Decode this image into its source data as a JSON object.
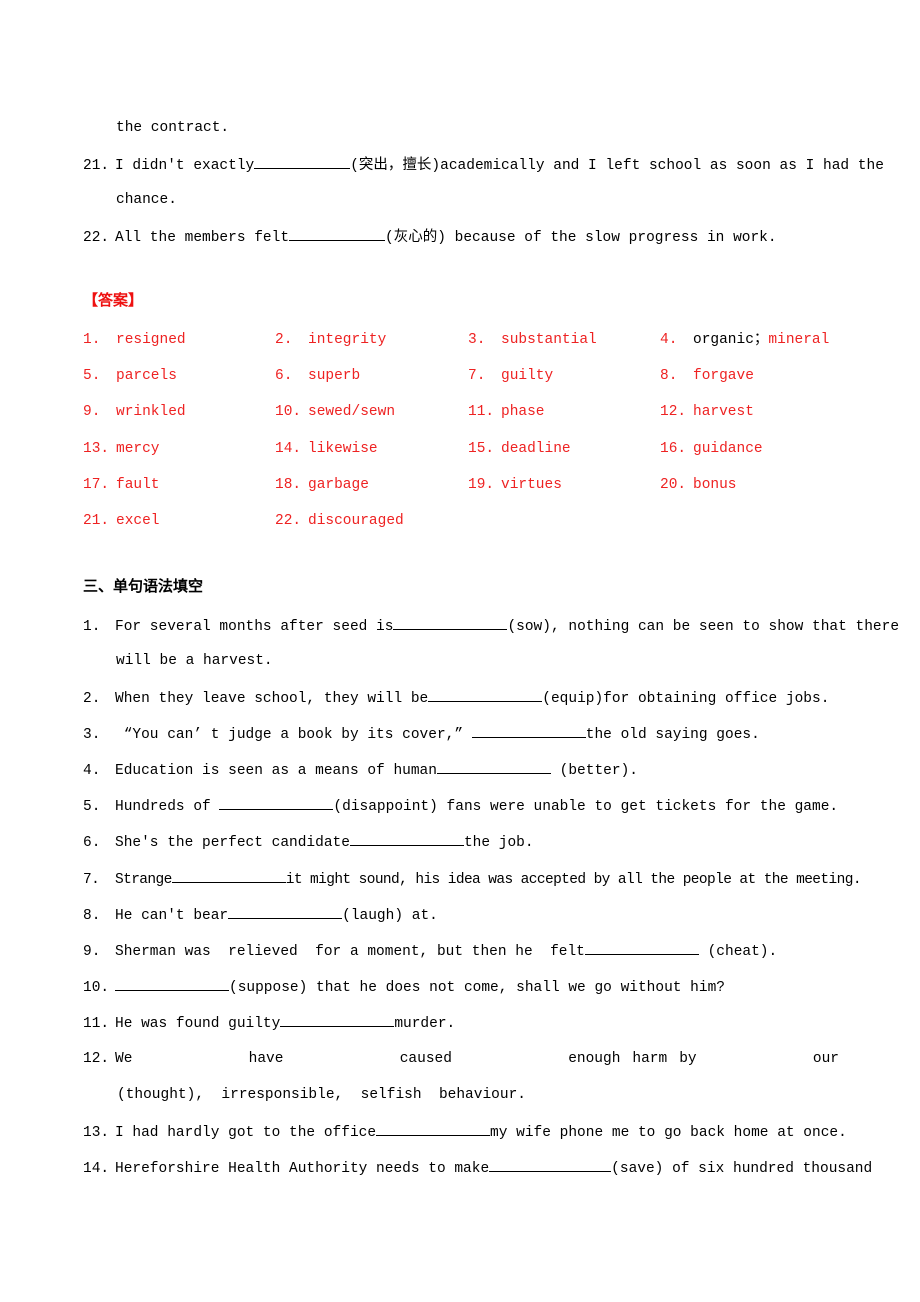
{
  "previous_items": [
    {
      "number": "",
      "text_parts": [
        "the contract."
      ]
    },
    {
      "number": "21.",
      "before": "I didn't exactly",
      "hint": "(突出，擅长)academically and I left school as soon as I had the",
      "continuation": "chance."
    },
    {
      "number": "22.",
      "before": "All the members felt",
      "hint": "(灰心的) because of the slow progress in work."
    }
  ],
  "answers": {
    "heading": "【答案】",
    "items": [
      {
        "number": "1.",
        "answer": "resigned"
      },
      {
        "number": "2.",
        "answer": "integrity"
      },
      {
        "number": "3.",
        "answer": "substantial"
      },
      {
        "number": "4.",
        "answer_black": "organic；",
        "answer": "mineral"
      },
      {
        "number": "5.",
        "answer": "parcels"
      },
      {
        "number": "6.",
        "answer": "superb"
      },
      {
        "number": "7.",
        "answer": "guilty"
      },
      {
        "number": "8.",
        "answer": "forgave"
      },
      {
        "number": "9.",
        "answer": "wrinkled"
      },
      {
        "number": "10.",
        "answer": "sewed/sewn"
      },
      {
        "number": "11.",
        "answer": "phase"
      },
      {
        "number": "12.",
        "answer": "harvest"
      },
      {
        "number": "13.",
        "answer": "mercy"
      },
      {
        "number": "14.",
        "answer": "likewise"
      },
      {
        "number": "15.",
        "answer": "deadline"
      },
      {
        "number": "16.",
        "answer": "guidance"
      },
      {
        "number": "17.",
        "answer": "fault"
      },
      {
        "number": "18.",
        "answer": "garbage"
      },
      {
        "number": "19.",
        "answer": "virtues"
      },
      {
        "number": "20.",
        "answer": "bonus"
      },
      {
        "number": "21.",
        "answer": "excel"
      },
      {
        "number": "22.",
        "answer": "discouraged"
      }
    ]
  },
  "section3": {
    "heading": "三、单句语法填空",
    "items": [
      {
        "number": "1.",
        "before": "For several months after seed is",
        "after": "(sow), nothing can be seen to show that there",
        "continuation": "will be a harvest."
      },
      {
        "number": "2.",
        "before": "When they leave school, they will be",
        "after": "(equip)for obtaining office jobs."
      },
      {
        "number": "3.",
        "before": " “You can’ t judge a book by its cover,” ",
        "after": "the old saying goes."
      },
      {
        "number": "4.",
        "before": "Education is seen as a means of human",
        "after": " (better)."
      },
      {
        "number": "5.",
        "before": "Hundreds of ",
        "after": "(disappoint) fans were unable to get tickets for the game."
      },
      {
        "number": "6.",
        "before": "She's the perfect candidate",
        "after": "the job."
      },
      {
        "number": "7.",
        "before": "Strange",
        "after": "it might sound, his idea was accepted by all the people at the meeting."
      },
      {
        "number": "8.",
        "before": "He can't bear",
        "after": "(laugh) at."
      },
      {
        "number": "9.",
        "before": "Sherman was  relieved  for a moment, but then he  felt",
        "after": " (cheat)."
      },
      {
        "number": "10.",
        "before": "",
        "after": "(suppose) that he does not come, shall we go without him?"
      },
      {
        "number": "11.",
        "before": "He was found guilty",
        "after": "murder."
      },
      {
        "number": "12.",
        "words": [
          "We",
          "have",
          "caused",
          "enough",
          "harm",
          "by",
          "our"
        ],
        "continuation": "(thought),  irresponsible,  selfish  behaviour."
      },
      {
        "number": "13.",
        "before": "I had hardly got to the office",
        "after": "my wife phone me to go back home at once."
      },
      {
        "number": "14.",
        "before": "Hereforshire Health Authority needs to make",
        "after": "(save) of six hundred thousand"
      }
    ]
  }
}
